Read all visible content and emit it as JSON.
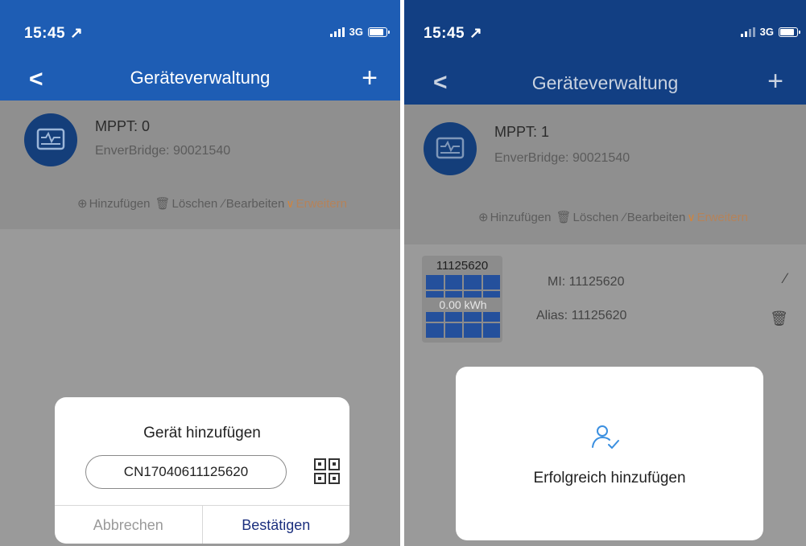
{
  "left": {
    "status": {
      "time": "15:45",
      "network": "3G"
    },
    "nav": {
      "back": "<",
      "title": "Geräteverwaltung",
      "add": "+"
    },
    "device": {
      "name": "MPPT: 0",
      "gateway": "EnverBridge: 90021540"
    },
    "actions": {
      "add": "Hinzufügen",
      "delete": "Löschen",
      "edit": "Bearbeiten",
      "expand": "Erweitern"
    },
    "dialog": {
      "title": "Gerät hinzufügen",
      "serial_value": "CN17040611125620",
      "cancel": "Abbrechen",
      "confirm": "Bestätigen"
    }
  },
  "right": {
    "status": {
      "time": "15:45",
      "network": "3G"
    },
    "nav": {
      "back": "<",
      "title": "Geräteverwaltung",
      "add": "+"
    },
    "device": {
      "name": "MPPT: 1",
      "gateway": "EnverBridge: 90021540"
    },
    "actions": {
      "add": "Hinzufügen",
      "delete": "Löschen",
      "edit": "Bearbeiten",
      "expand": "Erweitern"
    },
    "microinverter": {
      "serial": "11125620",
      "energy": "0.00 kWh",
      "mi_label": "MI: 11125620",
      "alias_label": "Alias: 11125620"
    },
    "toast": {
      "message": "Erfolgreich hinzufügen"
    }
  },
  "colors": {
    "nav_blue": "#1e5db4",
    "nav_blue_dimmed": "#123f83",
    "overlay_gray": "#9a9a9a",
    "expand_orange": "#d3843a",
    "confirm_blue": "#1b2f7e",
    "icon_blue": "#3a8fe0"
  },
  "icons": {
    "location": "location-arrow-icon",
    "signal": "signal-bars-icon",
    "battery": "battery-icon",
    "device": "monitor-pulse-icon",
    "add": "plus-circle-icon",
    "delete": "trash-icon",
    "edit": "pencil-icon",
    "expand": "chevron-down-icon",
    "qr": "qr-scan-icon",
    "success": "user-check-icon"
  }
}
